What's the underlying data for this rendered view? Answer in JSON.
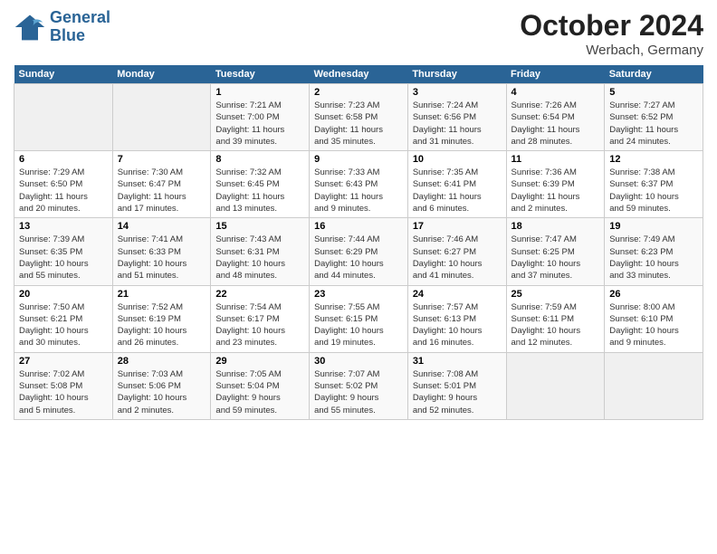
{
  "logo": {
    "line1": "General",
    "line2": "Blue"
  },
  "title": "October 2024",
  "subtitle": "Werbach, Germany",
  "days_header": [
    "Sunday",
    "Monday",
    "Tuesday",
    "Wednesday",
    "Thursday",
    "Friday",
    "Saturday"
  ],
  "weeks": [
    [
      {
        "num": "",
        "empty": true
      },
      {
        "num": "",
        "empty": true
      },
      {
        "num": "1",
        "info": "Sunrise: 7:21 AM\nSunset: 7:00 PM\nDaylight: 11 hours\nand 39 minutes."
      },
      {
        "num": "2",
        "info": "Sunrise: 7:23 AM\nSunset: 6:58 PM\nDaylight: 11 hours\nand 35 minutes."
      },
      {
        "num": "3",
        "info": "Sunrise: 7:24 AM\nSunset: 6:56 PM\nDaylight: 11 hours\nand 31 minutes."
      },
      {
        "num": "4",
        "info": "Sunrise: 7:26 AM\nSunset: 6:54 PM\nDaylight: 11 hours\nand 28 minutes."
      },
      {
        "num": "5",
        "info": "Sunrise: 7:27 AM\nSunset: 6:52 PM\nDaylight: 11 hours\nand 24 minutes."
      }
    ],
    [
      {
        "num": "6",
        "info": "Sunrise: 7:29 AM\nSunset: 6:50 PM\nDaylight: 11 hours\nand 20 minutes."
      },
      {
        "num": "7",
        "info": "Sunrise: 7:30 AM\nSunset: 6:47 PM\nDaylight: 11 hours\nand 17 minutes."
      },
      {
        "num": "8",
        "info": "Sunrise: 7:32 AM\nSunset: 6:45 PM\nDaylight: 11 hours\nand 13 minutes."
      },
      {
        "num": "9",
        "info": "Sunrise: 7:33 AM\nSunset: 6:43 PM\nDaylight: 11 hours\nand 9 minutes."
      },
      {
        "num": "10",
        "info": "Sunrise: 7:35 AM\nSunset: 6:41 PM\nDaylight: 11 hours\nand 6 minutes."
      },
      {
        "num": "11",
        "info": "Sunrise: 7:36 AM\nSunset: 6:39 PM\nDaylight: 11 hours\nand 2 minutes."
      },
      {
        "num": "12",
        "info": "Sunrise: 7:38 AM\nSunset: 6:37 PM\nDaylight: 10 hours\nand 59 minutes."
      }
    ],
    [
      {
        "num": "13",
        "info": "Sunrise: 7:39 AM\nSunset: 6:35 PM\nDaylight: 10 hours\nand 55 minutes."
      },
      {
        "num": "14",
        "info": "Sunrise: 7:41 AM\nSunset: 6:33 PM\nDaylight: 10 hours\nand 51 minutes."
      },
      {
        "num": "15",
        "info": "Sunrise: 7:43 AM\nSunset: 6:31 PM\nDaylight: 10 hours\nand 48 minutes."
      },
      {
        "num": "16",
        "info": "Sunrise: 7:44 AM\nSunset: 6:29 PM\nDaylight: 10 hours\nand 44 minutes."
      },
      {
        "num": "17",
        "info": "Sunrise: 7:46 AM\nSunset: 6:27 PM\nDaylight: 10 hours\nand 41 minutes."
      },
      {
        "num": "18",
        "info": "Sunrise: 7:47 AM\nSunset: 6:25 PM\nDaylight: 10 hours\nand 37 minutes."
      },
      {
        "num": "19",
        "info": "Sunrise: 7:49 AM\nSunset: 6:23 PM\nDaylight: 10 hours\nand 33 minutes."
      }
    ],
    [
      {
        "num": "20",
        "info": "Sunrise: 7:50 AM\nSunset: 6:21 PM\nDaylight: 10 hours\nand 30 minutes."
      },
      {
        "num": "21",
        "info": "Sunrise: 7:52 AM\nSunset: 6:19 PM\nDaylight: 10 hours\nand 26 minutes."
      },
      {
        "num": "22",
        "info": "Sunrise: 7:54 AM\nSunset: 6:17 PM\nDaylight: 10 hours\nand 23 minutes."
      },
      {
        "num": "23",
        "info": "Sunrise: 7:55 AM\nSunset: 6:15 PM\nDaylight: 10 hours\nand 19 minutes."
      },
      {
        "num": "24",
        "info": "Sunrise: 7:57 AM\nSunset: 6:13 PM\nDaylight: 10 hours\nand 16 minutes."
      },
      {
        "num": "25",
        "info": "Sunrise: 7:59 AM\nSunset: 6:11 PM\nDaylight: 10 hours\nand 12 minutes."
      },
      {
        "num": "26",
        "info": "Sunrise: 8:00 AM\nSunset: 6:10 PM\nDaylight: 10 hours\nand 9 minutes."
      }
    ],
    [
      {
        "num": "27",
        "info": "Sunrise: 7:02 AM\nSunset: 5:08 PM\nDaylight: 10 hours\nand 5 minutes."
      },
      {
        "num": "28",
        "info": "Sunrise: 7:03 AM\nSunset: 5:06 PM\nDaylight: 10 hours\nand 2 minutes."
      },
      {
        "num": "29",
        "info": "Sunrise: 7:05 AM\nSunset: 5:04 PM\nDaylight: 9 hours\nand 59 minutes."
      },
      {
        "num": "30",
        "info": "Sunrise: 7:07 AM\nSunset: 5:02 PM\nDaylight: 9 hours\nand 55 minutes."
      },
      {
        "num": "31",
        "info": "Sunrise: 7:08 AM\nSunset: 5:01 PM\nDaylight: 9 hours\nand 52 minutes."
      },
      {
        "num": "",
        "empty": true
      },
      {
        "num": "",
        "empty": true
      }
    ]
  ]
}
